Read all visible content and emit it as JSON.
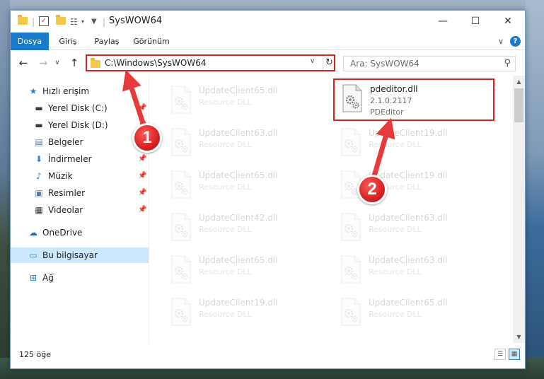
{
  "window": {
    "title": "SysWOW64",
    "minimize_glyph": "—",
    "maximize_glyph": "☐",
    "close_glyph": "✕"
  },
  "ribbon": {
    "tabs": [
      {
        "label": "Dosya",
        "active": true
      },
      {
        "label": "Giriş",
        "active": false
      },
      {
        "label": "Paylaş",
        "active": false
      },
      {
        "label": "Görünüm",
        "active": false
      }
    ],
    "expand_glyph": "∨",
    "help_glyph": "?"
  },
  "navbar": {
    "back_glyph": "←",
    "forward_glyph": "→",
    "recent_glyph": "∨",
    "up_glyph": "↑",
    "address": "C:\\Windows\\SysWOW64",
    "address_drop_glyph": "∨",
    "refresh_glyph": "↻",
    "search_placeholder": "Ara: SysWOW64",
    "search_glyph": "⚲"
  },
  "navpane": {
    "items": [
      {
        "label": "Hızlı erişim",
        "icon": "star-icon",
        "glyph": "★",
        "color": "#2a7fd4",
        "indent": 0,
        "pinned": false,
        "selected": false
      },
      {
        "label": "Yerel Disk (C:)",
        "icon": "drive-icon",
        "glyph": "▬",
        "color": "#3a3a3a",
        "indent": 1,
        "pinned": true,
        "selected": false
      },
      {
        "label": "Yerel Disk (D:)",
        "icon": "drive-icon",
        "glyph": "▬",
        "color": "#3a3a3a",
        "indent": 1,
        "pinned": true,
        "selected": false
      },
      {
        "label": "Belgeler",
        "icon": "documents-icon",
        "glyph": "▤",
        "color": "#5a7fa8",
        "indent": 1,
        "pinned": true,
        "selected": false
      },
      {
        "label": "İndirmeler",
        "icon": "downloads-icon",
        "glyph": "⬇",
        "color": "#2a7fd4",
        "indent": 1,
        "pinned": true,
        "selected": false
      },
      {
        "label": "Müzik",
        "icon": "music-icon",
        "glyph": "♪",
        "color": "#2a7fd4",
        "indent": 1,
        "pinned": true,
        "selected": false
      },
      {
        "label": "Resimler",
        "icon": "pictures-icon",
        "glyph": "▣",
        "color": "#5a7fa8",
        "indent": 1,
        "pinned": true,
        "selected": false
      },
      {
        "label": "Videolar",
        "icon": "videos-icon",
        "glyph": "▦",
        "color": "#3a3a3a",
        "indent": 1,
        "pinned": true,
        "selected": false
      },
      {
        "label": "OneDrive",
        "icon": "cloud-icon",
        "glyph": "☁",
        "color": "#1a6ec2",
        "indent": 0,
        "pinned": false,
        "selected": false
      },
      {
        "label": "Bu bilgisayar",
        "icon": "computer-icon",
        "glyph": "▭",
        "color": "#2a7fd4",
        "indent": 0,
        "pinned": false,
        "selected": true
      },
      {
        "label": "Ağ",
        "icon": "network-icon",
        "glyph": "⊞",
        "color": "#2a7fd4",
        "indent": 0,
        "pinned": false,
        "selected": false
      }
    ],
    "pin_glyph": "📌"
  },
  "files": [
    {
      "name": "UpdateClient65.dll",
      "sub": "Resource DLL",
      "sub2": "",
      "col": 0,
      "row": 0,
      "faded": true,
      "highlight": false
    },
    {
      "name": "pdeditor.dll",
      "sub": "2.1.0.2117",
      "sub2": "PDEditor",
      "col": 1,
      "row": 0,
      "faded": false,
      "highlight": true
    },
    {
      "name": "UpdateClient63.dll",
      "sub": "Resource DLL",
      "sub2": "",
      "col": 0,
      "row": 1,
      "faded": true,
      "highlight": false
    },
    {
      "name": "UpdateClient19.dll",
      "sub": "Resource DLL",
      "sub2": "",
      "col": 1,
      "row": 1,
      "faded": true,
      "highlight": false
    },
    {
      "name": "UpdateClient65.dll",
      "sub": "Resource DLL",
      "sub2": "",
      "col": 0,
      "row": 2,
      "faded": true,
      "highlight": false
    },
    {
      "name": "UpdateClient19.dll",
      "sub": "Resource DLL",
      "sub2": "",
      "col": 1,
      "row": 2,
      "faded": true,
      "highlight": false
    },
    {
      "name": "UpdateClient42.dll",
      "sub": "Resource DLL",
      "sub2": "",
      "col": 0,
      "row": 3,
      "faded": true,
      "highlight": false
    },
    {
      "name": "UpdateClient63.dll",
      "sub": "Resource DLL",
      "sub2": "",
      "col": 1,
      "row": 3,
      "faded": true,
      "highlight": false
    },
    {
      "name": "UpdateClient65.dll",
      "sub": "Resource DLL",
      "sub2": "",
      "col": 0,
      "row": 4,
      "faded": true,
      "highlight": false
    },
    {
      "name": "UpdateClient63.dll",
      "sub": "Resource DLL",
      "sub2": "",
      "col": 1,
      "row": 4,
      "faded": true,
      "highlight": false
    },
    {
      "name": "UpdateClient19.dll",
      "sub": "Resource DLL",
      "sub2": "",
      "col": 0,
      "row": 5,
      "faded": true,
      "highlight": false
    },
    {
      "name": "UpdateClient65.dll",
      "sub": "Resource DLL",
      "sub2": "",
      "col": 1,
      "row": 5,
      "faded": true,
      "highlight": false
    }
  ],
  "scrollbar": {
    "up_glyph": "▲",
    "down_glyph": "▼"
  },
  "status": {
    "item_count": "125 öğe",
    "details_view_glyph": "☰",
    "tiles_view_glyph": "▦"
  },
  "annotations": {
    "badge1": "1",
    "badge2": "2",
    "highlight_color": "#e01e1e",
    "arrow_color": "#e83a3a"
  },
  "colors": {
    "accent": "#1979ca",
    "selection": "#cce8ff"
  }
}
